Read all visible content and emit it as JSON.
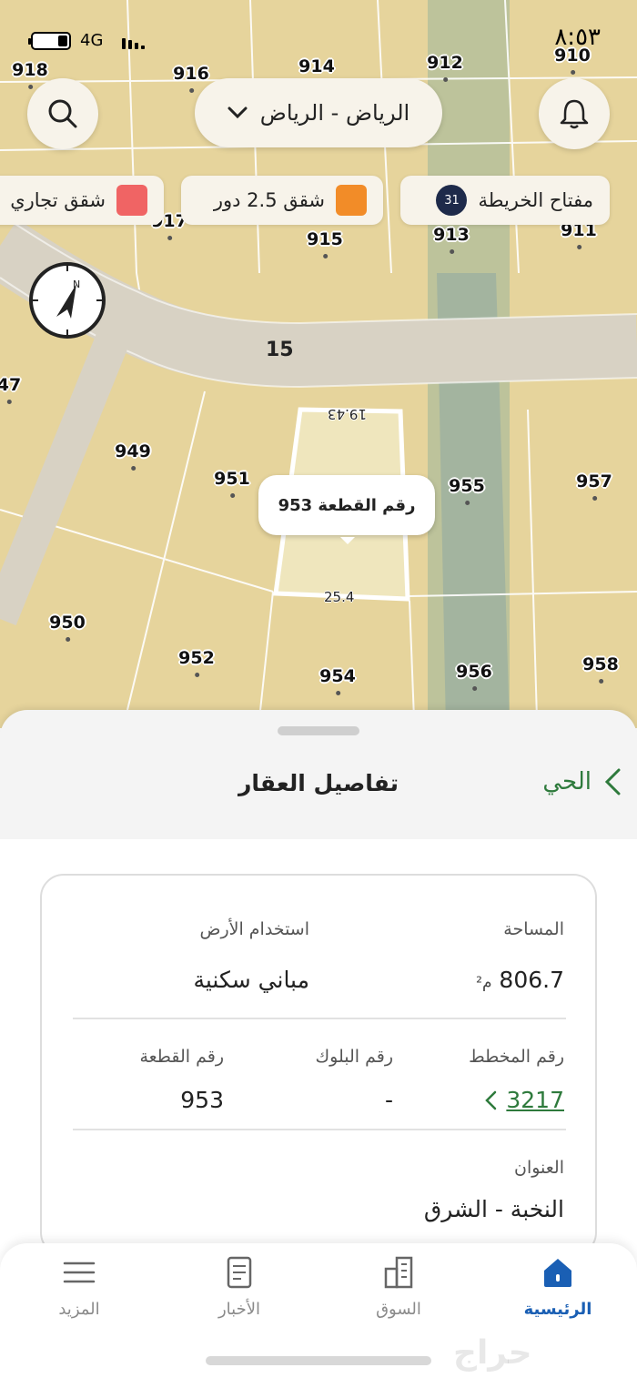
{
  "status_bar": {
    "time": "٨:٥٣",
    "network": "4G"
  },
  "map": {
    "city_selector": "الرياض - الرياض",
    "legend_chips": [
      {
        "label": "مفتاح الخريطة",
        "badge": "31"
      },
      {
        "label": "شقق 2.5 دور",
        "color": "#f28c28"
      },
      {
        "label": "شقق تجاري",
        "color": "#f06464"
      }
    ],
    "road_label": "15",
    "selected_plot": {
      "bubble_label": "رقم القطعة 953",
      "dimension_top": "19.43",
      "dimension_bottom": "25.4"
    },
    "plot_numbers": [
      "918",
      "916",
      "914",
      "912",
      "910",
      "917",
      "915",
      "913",
      "911",
      "47",
      "949",
      "951",
      "955",
      "957",
      "950",
      "952",
      "954",
      "956",
      "958"
    ]
  },
  "sheet": {
    "title": "تفاصيل العقار",
    "area_link": "الحي",
    "fields": {
      "area_label": "المساحة",
      "area_value": "806.7",
      "area_unit": "م²",
      "land_use_label": "استخدام الأرض",
      "land_use_value": "مباني سكنية",
      "scheme_label": "رقم المخطط",
      "scheme_value": "3217",
      "block_label": "رقم البلوك",
      "block_value": "-",
      "plot_label": "رقم القطعة",
      "plot_value": "953",
      "address_label": "العنوان",
      "address_value": "النخبة - الشرق"
    }
  },
  "nav": {
    "items": [
      {
        "label": "الرئيسية",
        "icon": "home-icon",
        "active": true
      },
      {
        "label": "السوق",
        "icon": "buildings-icon"
      },
      {
        "label": "الأخبار",
        "icon": "news-icon"
      },
      {
        "label": "المزيد",
        "icon": "menu-icon"
      }
    ],
    "watermark": "حراج"
  }
}
